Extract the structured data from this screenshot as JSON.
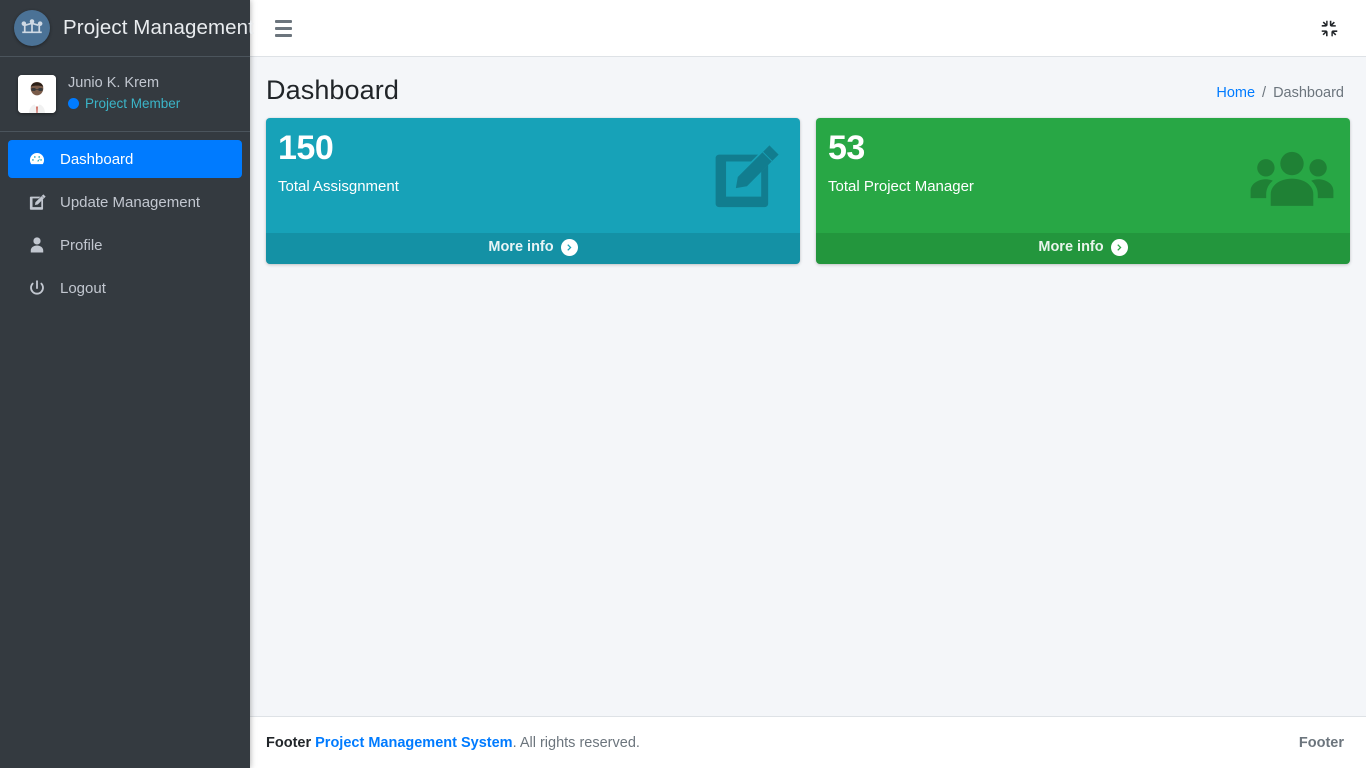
{
  "brand": {
    "title": "Project Management",
    "logo_icon": "project-network-icon"
  },
  "user": {
    "name": "Junio K. Krem",
    "role": "Project Member",
    "role_dot_color": "#007bff",
    "avatar_icon": "user-avatar"
  },
  "sidebar": {
    "bg_color": "#343a40",
    "active_color": "#007bff",
    "items": [
      {
        "label": "Dashboard",
        "icon": "tachometer-dashboard-icon",
        "active": true
      },
      {
        "label": "Update Management",
        "icon": "edit-square-icon",
        "active": false
      },
      {
        "label": "Profile",
        "icon": "user-icon",
        "active": false
      },
      {
        "label": "Logout",
        "icon": "power-off-icon",
        "active": false
      }
    ]
  },
  "topbar": {
    "menu_icon": "hamburger-menu-icon",
    "fullscreen_icon": "compress-arrows-icon"
  },
  "content_header": {
    "title": "Dashboard",
    "breadcrumb": {
      "home": "Home",
      "separator": "/",
      "current": "Dashboard"
    }
  },
  "cards": [
    {
      "value": "150",
      "label": "Total Assisgnment",
      "footer_label": "More info",
      "icon": "edit-square-icon",
      "color": "#17a2b8",
      "footer_color": "#148ea1"
    },
    {
      "value": "53",
      "label": "Total Project Manager",
      "footer_label": "More info",
      "icon": "users-group-icon",
      "color": "#28a745",
      "footer_color": "#23923d"
    }
  ],
  "footer": {
    "prefix": "Footer",
    "link": "Project Management System",
    "suffix": ". All rights reserved.",
    "right": "Footer"
  }
}
